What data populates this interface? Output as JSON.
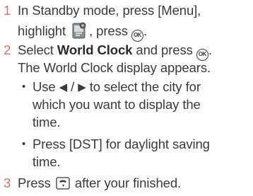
{
  "colors": {
    "step_number": "#e07070",
    "text": "#3a3a3a"
  },
  "steps": [
    {
      "number": "1",
      "line1": "In Standby mode, press [Menu],",
      "line2_before": "highlight",
      "line2_icon": "settings-menu-icon",
      "line2_after": ", press",
      "line2_icon2": "ok-key-icon",
      "line2_end": "."
    },
    {
      "number": "2",
      "line1_before": "Select",
      "line1_bold": "World Clock",
      "line1_after": "and press",
      "line1_icon": "ok-key-icon",
      "line1_end": ".",
      "line2": "The World Clock display appears.",
      "bullets": [
        {
          "line1_icon_left": "left-arrow-key",
          "line1_before": "Use",
          "line1_sep": "/",
          "line1_after": "to select the city for",
          "line2": "which you want to display the",
          "line3": "time."
        },
        {
          "line1": "Press [DST] for daylight saving",
          "line2": "time."
        }
      ]
    },
    {
      "number": "3",
      "line1_before": "Press",
      "line1_icon": "end-key-icon",
      "line1_after": "after your finished."
    }
  ],
  "ok_key_label": "OK"
}
